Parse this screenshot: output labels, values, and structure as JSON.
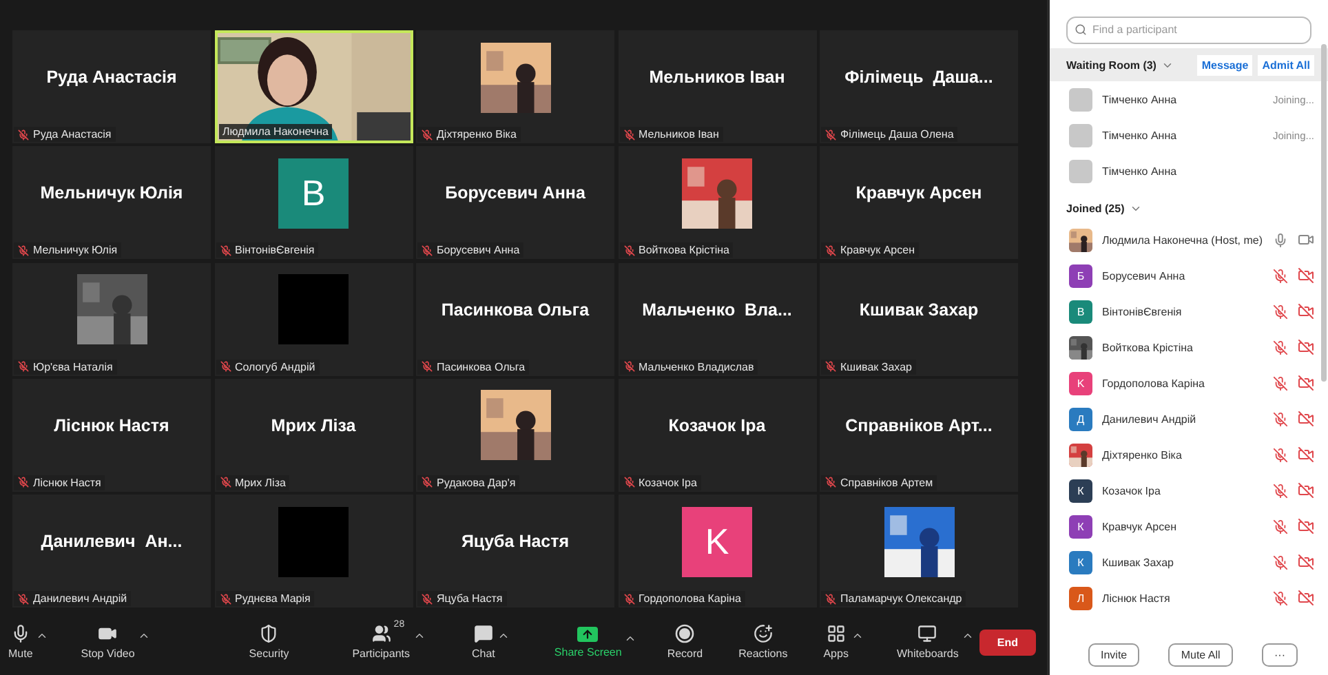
{
  "tiles": [
    {
      "kind": "name",
      "title": "Руда Анастасія",
      "label": "Руда Анастасія",
      "muted": true,
      "speaking": false
    },
    {
      "kind": "video",
      "label": "Людмила Наконечна",
      "muted": false,
      "speaking": true
    },
    {
      "kind": "picture",
      "label": "Діхтяренко Віка",
      "muted": true,
      "speaking": false
    },
    {
      "kind": "name",
      "title": "Мельников Іван",
      "label": "Мельников Іван",
      "muted": true,
      "speaking": false
    },
    {
      "kind": "name",
      "title": "Філімець  Даша...",
      "label": "Філімець Даша Олена",
      "muted": true,
      "speaking": false
    },
    {
      "kind": "name",
      "title": "Мельничук Юлія",
      "label": "Мельничук Юлія",
      "muted": true,
      "speaking": false
    },
    {
      "kind": "avatar",
      "letter": "B",
      "color": "#1a8a7a",
      "label": "ВінтонівЄвгенія",
      "muted": true,
      "speaking": false
    },
    {
      "kind": "name",
      "title": "Борусевич Анна",
      "label": "Борусевич Анна",
      "muted": true,
      "speaking": false
    },
    {
      "kind": "picture",
      "label": "Войткова Крістіна",
      "muted": true,
      "speaking": false
    },
    {
      "kind": "name",
      "title": "Кравчук Арсен",
      "label": "Кравчук Арсен",
      "muted": true,
      "speaking": false
    },
    {
      "kind": "picture",
      "label": "Юр'єва Наталія",
      "muted": true,
      "speaking": false
    },
    {
      "kind": "blank",
      "label": "Сологуб Андрій",
      "muted": true,
      "speaking": false
    },
    {
      "kind": "name",
      "title": "Пасинкова Ольга",
      "label": "Пасинкова Ольга",
      "muted": true,
      "speaking": false
    },
    {
      "kind": "name",
      "title": "Мальченко  Вла...",
      "label": "Мальченко Владислав",
      "muted": true,
      "speaking": false
    },
    {
      "kind": "name",
      "title": "Кшивак Захар",
      "label": "Кшивак Захар",
      "muted": true,
      "speaking": false
    },
    {
      "kind": "name",
      "title": "Ліснюк Настя",
      "label": "Ліснюк Настя",
      "muted": true,
      "speaking": false
    },
    {
      "kind": "name",
      "title": "Мрих Ліза",
      "label": "Мрих Ліза",
      "muted": true,
      "speaking": false
    },
    {
      "kind": "picture",
      "label": "Рудакова Дар'я",
      "muted": true,
      "speaking": false
    },
    {
      "kind": "name",
      "title": "Козачок Іра",
      "label": "Козачок Іра",
      "muted": true,
      "speaking": false
    },
    {
      "kind": "name",
      "title": "Справніков Арт...",
      "label": "Справніков Артем",
      "muted": true,
      "speaking": false
    },
    {
      "kind": "name",
      "title": "Данилевич  Ан...",
      "label": "Данилевич Андрій",
      "muted": true,
      "speaking": false
    },
    {
      "kind": "blank",
      "label": "Руднєва Марія",
      "muted": true,
      "speaking": false
    },
    {
      "kind": "name",
      "title": "Яцуба Настя",
      "label": "Яцуба Настя",
      "muted": true,
      "speaking": false
    },
    {
      "kind": "avatar",
      "letter": "K",
      "color": "#e8417a",
      "label": "Гордополова Каріна",
      "muted": true,
      "speaking": false
    },
    {
      "kind": "picture",
      "label": "Паламарчук Олександр",
      "muted": true,
      "speaking": false
    }
  ],
  "toolbar": [
    {
      "kind": "mic",
      "label": "Mute",
      "caret": true
    },
    {
      "kind": "video",
      "label": "Stop Video",
      "caret": true
    },
    {
      "kind": "security",
      "label": "Security",
      "caret": false
    },
    {
      "kind": "participants",
      "label": "Participants",
      "count": "28",
      "caret": true
    },
    {
      "kind": "chat",
      "label": "Chat",
      "caret": true
    },
    {
      "kind": "share",
      "label": "Share Screen",
      "caret": true
    },
    {
      "kind": "record",
      "label": "Record",
      "caret": false
    },
    {
      "kind": "reactions",
      "label": "Reactions",
      "caret": false
    },
    {
      "kind": "apps",
      "label": "Apps",
      "caret": true
    },
    {
      "kind": "whiteboards",
      "label": "Whiteboards",
      "caret": true
    }
  ],
  "end_button": "End",
  "panel": {
    "search": {
      "placeholder": "Find a participant"
    },
    "waiting": {
      "title": "Waiting Room (3)",
      "buttons": [
        "Message",
        "Admit All"
      ],
      "rows": [
        {
          "name": "Тімченко Анна",
          "status": "Joining..."
        },
        {
          "name": "Тімченко Анна",
          "status": "Joining..."
        },
        {
          "name": "Тімченко Анна"
        }
      ]
    },
    "joined": {
      "title": "Joined (25)",
      "rows": [
        {
          "kind": "picture",
          "name": "Людмила Наконечна (Host, me)",
          "muted": false,
          "video_on": true
        },
        {
          "kind": "letter",
          "letter": "Б",
          "color": "#8e3fb5",
          "name": "Борусевич Анна",
          "muted": true,
          "video_on": false
        },
        {
          "kind": "letter",
          "letter": "B",
          "color": "#1a8a7a",
          "name": "ВінтонівЄвгенія",
          "muted": true,
          "video_on": false
        },
        {
          "kind": "picture",
          "name": "Войткова Крістіна",
          "muted": true,
          "video_on": false
        },
        {
          "kind": "letter",
          "letter": "K",
          "color": "#e8417a",
          "name": "Гордополова Каріна",
          "muted": true,
          "video_on": false
        },
        {
          "kind": "letter",
          "letter": "Д",
          "color": "#2a7bbf",
          "name": "Данилевич Андрій",
          "muted": true,
          "video_on": false
        },
        {
          "kind": "picture",
          "name": "Діхтяренко Віка",
          "muted": true,
          "video_on": false
        },
        {
          "kind": "letter",
          "letter": "К",
          "color": "#2c3e55",
          "name": "Козачок Іра",
          "muted": true,
          "video_on": false
        },
        {
          "kind": "letter",
          "letter": "К",
          "color": "#8e3fb5",
          "name": "Кравчук Арсен",
          "muted": true,
          "video_on": false
        },
        {
          "kind": "letter",
          "letter": "К",
          "color": "#2a7bbf",
          "name": "Кшивак Захар",
          "muted": true,
          "video_on": false
        },
        {
          "kind": "letter",
          "letter": "Л",
          "color": "#d9581a",
          "name": "Ліснюк Настя",
          "muted": true,
          "video_on": false
        }
      ]
    },
    "footer": [
      "Invite",
      "Mute All",
      "···"
    ]
  }
}
